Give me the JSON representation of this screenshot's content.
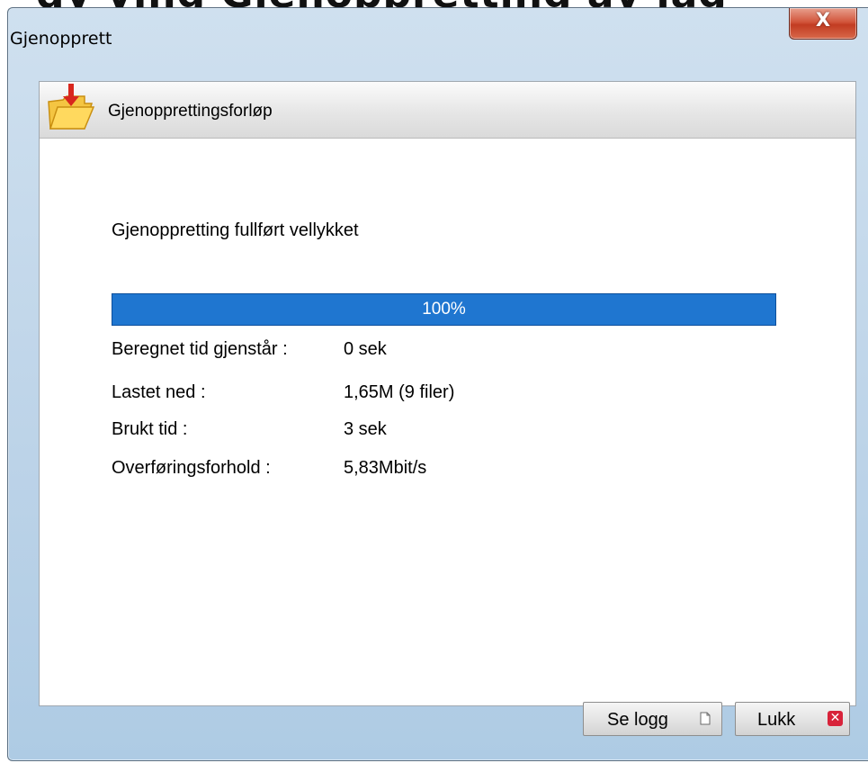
{
  "background_text": "dy ving Gjenoppretting av lag",
  "window": {
    "title": "Gjenopprett",
    "close_label": "X"
  },
  "section": {
    "title": "Gjenopprettingsforløp",
    "icon": "folder-download-icon"
  },
  "status_text": "Gjenoppretting fullført vellykket",
  "progress": {
    "value_percent": 100,
    "label": "100%"
  },
  "info": [
    {
      "label": "Beregnet tid gjenstår :",
      "value": "0 sek"
    },
    {
      "label": "Lastet ned :",
      "value": "1,65M (9 filer)"
    },
    {
      "label": "Brukt tid :",
      "value": "3 sek"
    },
    {
      "label": "Overføringsforhold :",
      "value": "5,83Mbit/s"
    }
  ],
  "buttons": {
    "view_log": {
      "label": "Se logg",
      "icon": "document-icon"
    },
    "close": {
      "label": "Lukk",
      "icon": "close-x-icon"
    }
  },
  "colors": {
    "progress": "#1f76d0",
    "close_accent": "#d8233a"
  }
}
